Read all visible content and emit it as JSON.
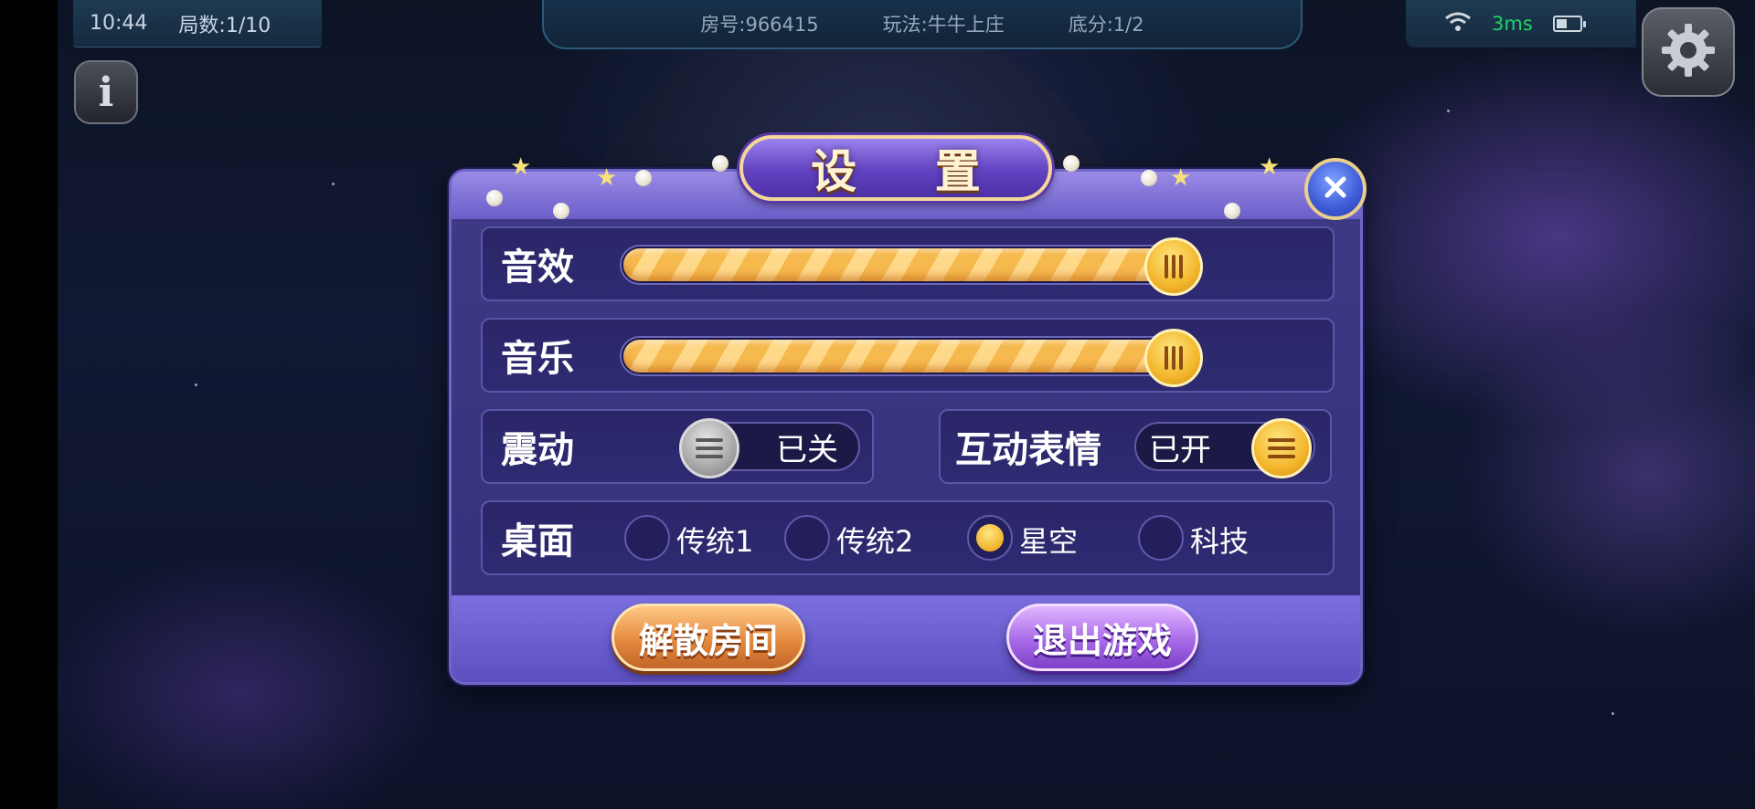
{
  "status_bar": {
    "time": "10:44",
    "round": "局数:1/10",
    "room": "房号:966415",
    "mode": "玩法:牛牛上庄",
    "base_score": "底分:1/2",
    "ping": "3ms",
    "battery_level": 0.45
  },
  "settings": {
    "title": "设 置",
    "sound_effects": {
      "label": "音效",
      "level": 1.0
    },
    "music": {
      "label": "音乐",
      "level": 1.0
    },
    "vibration": {
      "label": "震动",
      "state": "已关"
    },
    "emotes": {
      "label": "互动表情",
      "state": "已开"
    },
    "table": {
      "label": "桌面",
      "options": [
        "传统1",
        "传统2",
        "星空",
        "科技"
      ],
      "selected": "星空"
    },
    "buttons": {
      "dissolve": "解散房间",
      "exit": "退出游戏"
    }
  },
  "icons": [
    "wifi-icon",
    "battery-icon",
    "gear-icon",
    "info-icon",
    "close-icon"
  ],
  "colors": {
    "ping": "#1fd36b",
    "accent_gold": "#f3b62c",
    "panel": "#3f3a86"
  }
}
